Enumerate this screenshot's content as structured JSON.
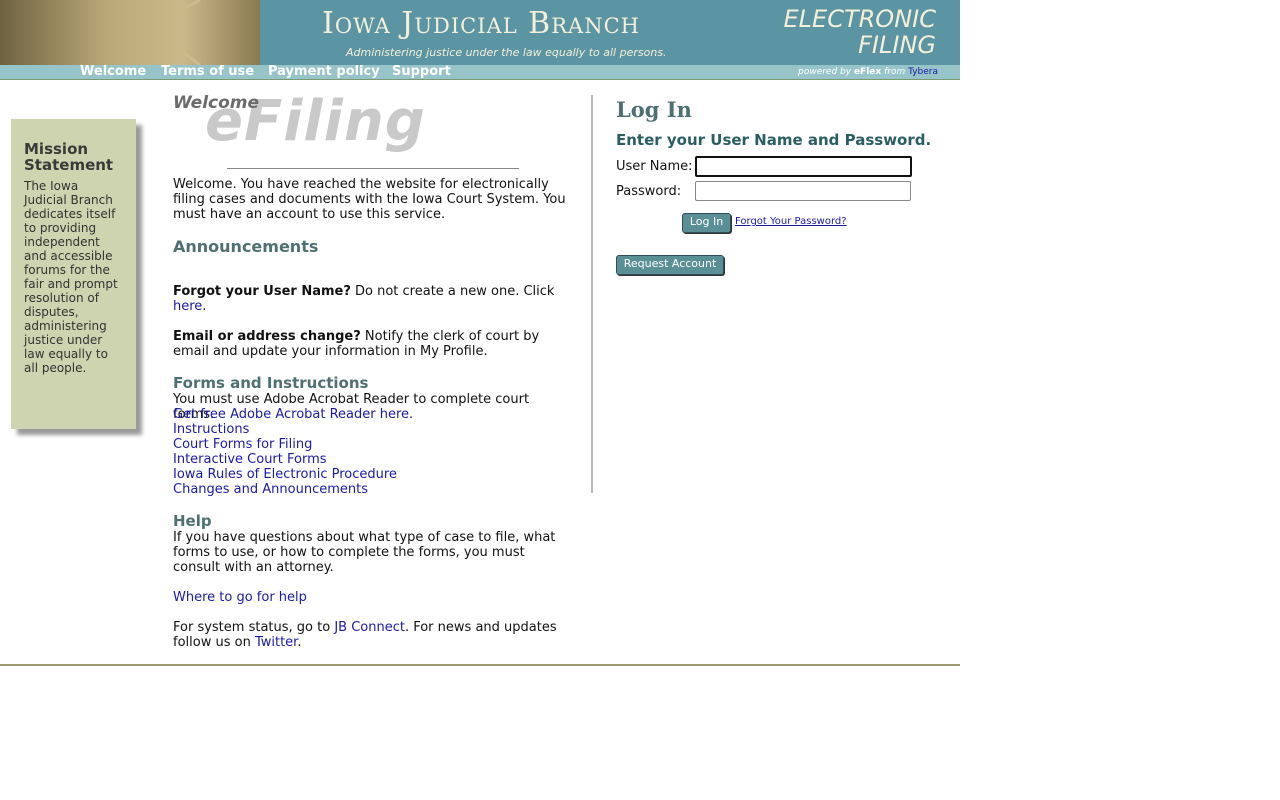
{
  "header": {
    "title": "Iowa Judicial Branch",
    "tagline": "Administering justice under the law equally to all persons.",
    "ef_line1": "ELECTRONIC",
    "ef_line2": "FILING"
  },
  "nav": {
    "items": [
      "Welcome",
      "Terms of use",
      "Payment policy",
      "Support"
    ],
    "powered_prefix": "powered by",
    "powered_product": "eFlex",
    "powered_from": "from",
    "powered_vendor": "Tybera"
  },
  "mission": {
    "title": "Mission Statement",
    "text": "The Iowa Judicial Branch dedicates itself to providing independent and accessible forums for the fair and prompt resolution of disputes, administering justice under law equally to all people."
  },
  "welcome": {
    "welcome_word": "Welcome",
    "efiling_word": "eFiling",
    "intro": "Welcome. You have reached the website for electronically filing cases and documents with the Iowa Court System. You must have an account to use this service.",
    "announcements_heading": "Announcements",
    "forgot_bold": "Forgot your User Name?",
    "forgot_text": " Do not create a new one. Click ",
    "forgot_link": "here",
    "forgot_end": ".",
    "email_bold": "Email or address change?",
    "email_text": " Notify the clerk of court by email and update your information in My Profile.",
    "forms_heading": "Forms and Instructions",
    "forms_text": "You must use Adobe Acrobat Reader to complete court forms.",
    "forms_links": [
      "Get free Adobe Acrobat Reader here.",
      "Instructions",
      "Court Forms for Filing",
      "Interactive Court Forms",
      "Iowa Rules of Electronic Procedure",
      "Changes and Announcements"
    ],
    "help_heading": "Help",
    "help_text": "If you have questions about what type of case to file, what forms to use, or how to complete the forms, you must consult with an attorney.",
    "help_link": "Where to go for help",
    "status_pre": "For system status, go to ",
    "status_link": "JB Connect",
    "status_mid": ". For news and updates follow us on ",
    "status_link2": "Twitter",
    "status_end": "."
  },
  "login": {
    "title": "Log In",
    "subtitle": "Enter your User Name and Password.",
    "user_label": "User Name:",
    "user_value": "",
    "pass_label": "Password:",
    "pass_value": "",
    "login_button": "Log In",
    "forgot_link": "Forgot Your Password?",
    "request_button": "Request Account"
  }
}
